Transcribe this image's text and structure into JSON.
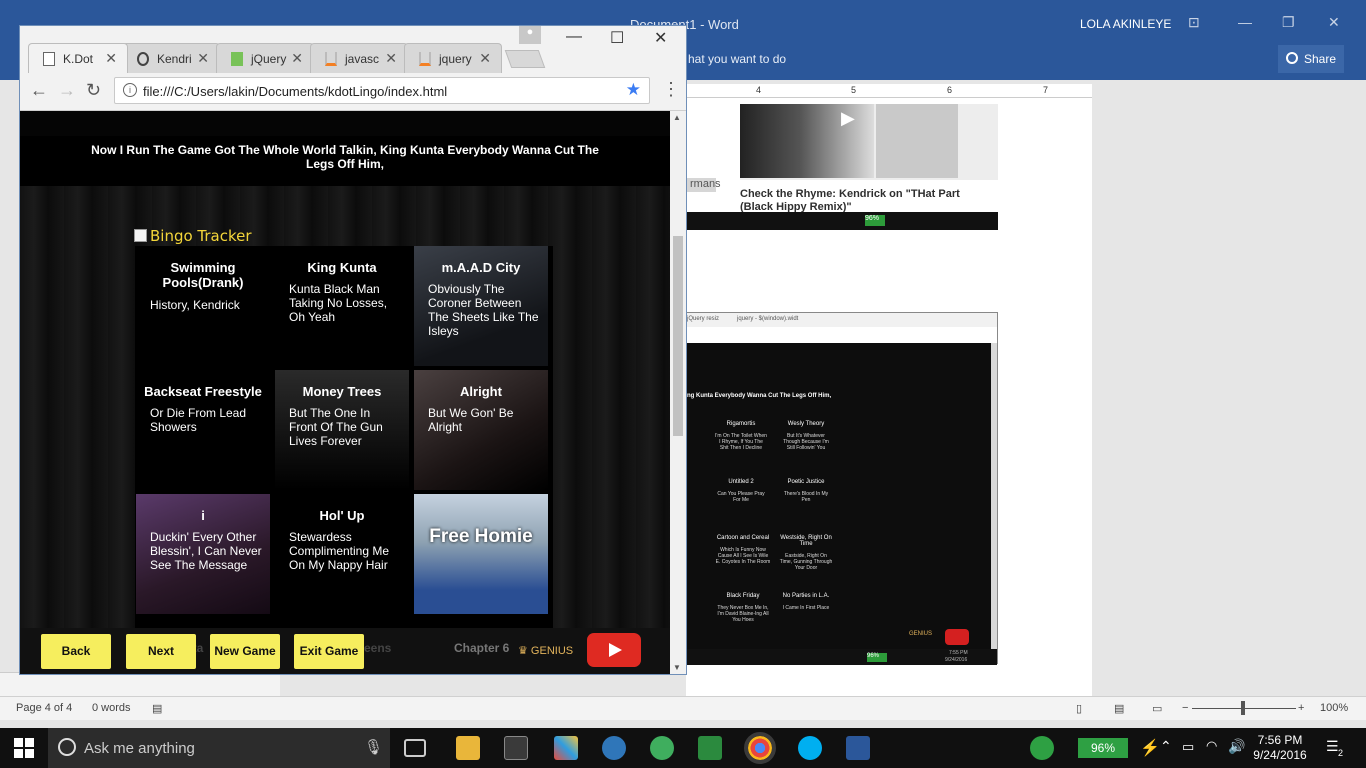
{
  "word": {
    "title": "Document1 - Word",
    "user": "LOLA AKINLEYE",
    "tell_me": "hat you want to do",
    "share": "Share",
    "ruler_marks": [
      "4",
      "5",
      "6",
      "7"
    ],
    "doc_caption": "Check the Rhyme: Kendrick on \"THat Part (Black Hippy Remix)\"",
    "doc_fragment": "rmans",
    "status": {
      "page": "Page 4 of 4",
      "words": "0 words",
      "zoom": "100%"
    }
  },
  "thumbnail": {
    "tab1": "jQuery resiz",
    "tab2": "jquery - $(window).widt",
    "lyric": "ng Kunta Everybody Wanna Cut The Legs Off Him,",
    "battery": "96%",
    "time": "7:55 PM",
    "date": "9/24/2016",
    "genius": "GENIUS",
    "cells": [
      {
        "title": "Rigamortis",
        "desc": "I'm On The Toilet When I Rhyme, If You The Shit Then I Decline"
      },
      {
        "title": "Wesly Theory",
        "desc": "But It's Whatever Though Because I'm Still Followin' You"
      },
      {
        "title": "Untitled 2",
        "desc": "Can You Please Pray For Me"
      },
      {
        "title": "Poetic Justice",
        "desc": "There's Blood In My Pen"
      },
      {
        "title": "Cartoon and Cereal",
        "desc": "Which Is Funny Now Cause All I See Is Wile E. Coyotes In The Room"
      },
      {
        "title": "Westside, Right On Time",
        "desc": "Eastside, Right On Time, Gunning Through Your Door"
      },
      {
        "title": "Black Friday",
        "desc": "They Never Box Me In, I'm David Blaine-Ing All You Hoes"
      },
      {
        "title": "No Parties in L.A.",
        "desc": "I Came In First Place"
      }
    ]
  },
  "chrome": {
    "tabs": [
      {
        "label": "K.Dot",
        "icon": "page-icon"
      },
      {
        "label": "Kendri",
        "icon": "genius-icon"
      },
      {
        "label": "jQuery",
        "icon": "jquery-icon"
      },
      {
        "label": "javasc",
        "icon": "stackoverflow-icon"
      },
      {
        "label": "jquery",
        "icon": "stackoverflow-icon"
      }
    ],
    "url": "file:///C:/Users/lakin/Documents/kdotLingo/index.html"
  },
  "game": {
    "lyric": "Now I Run The Game Got The Whole World Talkin, King Kunta Everybody Wanna Cut The Legs Off Him,",
    "tracker_title": "Bingo Tracker",
    "cells": [
      {
        "title": "Swimming Pools(Drank)",
        "desc": "History, Kendrick"
      },
      {
        "title": "King Kunta",
        "desc": "Kunta Black Man Taking No Losses, Oh Yeah"
      },
      {
        "title": "m.A.A.D City",
        "desc": "Obviously The Coroner Between The Sheets Like The Isleys"
      },
      {
        "title": "Backseat Freestyle",
        "desc": "Or Die From Lead Showers"
      },
      {
        "title": "Money Trees",
        "desc": "But The One In Front Of The Gun Lives Forever"
      },
      {
        "title": "Alright",
        "desc": "But We Gon' Be Alright"
      },
      {
        "title": "i",
        "desc": "Duckin' Every Other Blessin', I Can Never See The Message"
      },
      {
        "title": "Hol' Up",
        "desc": "Stewardess Complimenting Me On My Nappy Hair"
      },
      {
        "title": "Free Homie",
        "desc": ""
      }
    ],
    "buttons": {
      "back": "Back",
      "next": "Next",
      "new_game": "New Game",
      "exit_game": "Exit Game"
    },
    "behind": {
      "left": "eta",
      "mid": "eens",
      "right": "Chapter 6"
    },
    "genius": "GENIUS"
  },
  "taskbar": {
    "search": "Ask me anything",
    "battery": "96%",
    "time": "7:56 PM",
    "date": "9/24/2016",
    "notifications": "2"
  },
  "colors": {
    "word_blue": "#2b579a",
    "tile_yellow": "#f6ee5e",
    "tracker_gold": "#f4d63a",
    "youtube_red": "#df2a22"
  }
}
